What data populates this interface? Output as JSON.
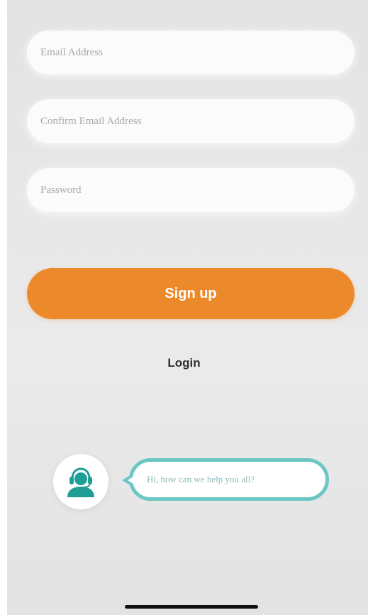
{
  "form": {
    "email": {
      "placeholder": "Email Address",
      "value": ""
    },
    "confirm_email": {
      "placeholder": "Confirm Email Address",
      "value": ""
    },
    "password": {
      "placeholder": "Password",
      "value": ""
    }
  },
  "actions": {
    "signup_label": "Sign up",
    "login_label": "Login"
  },
  "support": {
    "bubble_text": "Hi, how can we help you all?",
    "avatar_icon": "customer-support-icon"
  },
  "colors": {
    "accent": "#ec892a",
    "support_teal": "#6cc7c4",
    "avatar_teal": "#1f9e95"
  },
  "icons": [
    "customer-support-icon"
  ]
}
